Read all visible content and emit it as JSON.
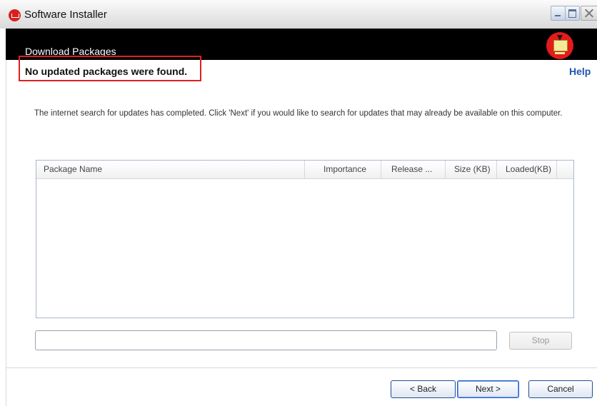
{
  "window": {
    "title": "Software Installer",
    "icons": {
      "app": "installer-app-icon",
      "header": "download-package-icon"
    },
    "colors": {
      "header_bg": "#000000",
      "accent": "#e31b1b",
      "link": "#1f56b3",
      "highlight_box": "#e02020"
    }
  },
  "header": {
    "title": "Download Packages"
  },
  "status": {
    "message": "No updated packages were found."
  },
  "help_label": "Help",
  "description": "The internet search for updates has completed. Click 'Next' if you would like to search for updates that may already be available on this computer.",
  "package_list": {
    "columns": [
      "Package Name",
      "Importance",
      "Release ...",
      "Size (KB)",
      "Loaded(KB)"
    ],
    "rows": []
  },
  "progress": {
    "value": 0
  },
  "buttons": {
    "stop": "Stop",
    "back": "< Back",
    "next": "Next >",
    "cancel": "Cancel"
  }
}
